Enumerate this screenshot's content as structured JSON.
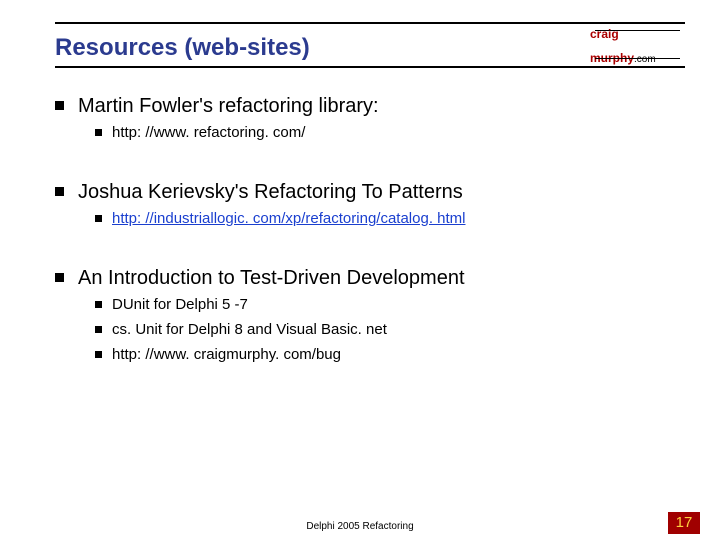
{
  "title": "Resources (web-sites)",
  "logo": {
    "line1": "craig",
    "line2a": "murphy",
    "line2b": ".com"
  },
  "sections": [
    {
      "heading": "Martin Fowler's refactoring library:",
      "items": [
        {
          "text": "http: //www. refactoring. com/",
          "link": false
        }
      ]
    },
    {
      "heading": "Joshua Kerievsky's Refactoring To Patterns",
      "items": [
        {
          "text": "http: //industriallogic. com/xp/refactoring/catalog. html",
          "link": true
        }
      ]
    },
    {
      "heading": "An Introduction to Test-Driven Development",
      "items": [
        {
          "text": "DUnit for Delphi 5 -7",
          "link": false
        },
        {
          "text": "cs. Unit for Delphi 8 and Visual Basic. net",
          "link": false
        },
        {
          "text": "http: //www. craigmurphy. com/bug",
          "link": false
        }
      ]
    }
  ],
  "footer": "Delphi 2005 Refactoring",
  "page_number": "17"
}
